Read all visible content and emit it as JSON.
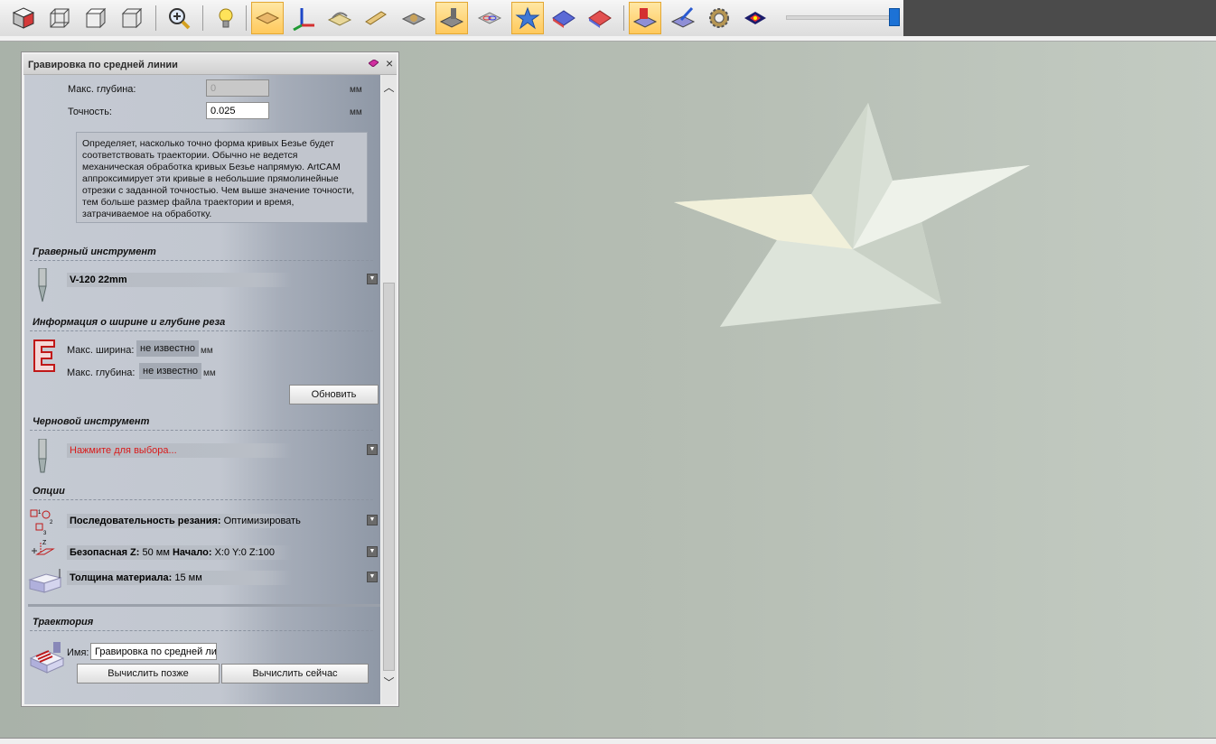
{
  "toolbar": {
    "icons": [
      "cube-icon",
      "wireframe-cube-icon",
      "box-outline-icon",
      "box-front-icon",
      "zoom-icon",
      "bulb-icon",
      "plane-view-icon",
      "axes-icon",
      "toolpath-icon",
      "material-block-icon",
      "relief-icon",
      "machine-icon",
      "layers-icon",
      "star-relief-icon",
      "blue-plane-icon",
      "red-plane-icon",
      "red-tool-icon",
      "paint-brush-icon",
      "gear-icon",
      "shading-icon"
    ]
  },
  "panel": {
    "title": "Гравировка по средней линии",
    "max_depth_label": "Макс. глубина:",
    "max_depth_value": "0",
    "max_depth_unit": "мм",
    "accuracy_label": "Точность:",
    "accuracy_value": "0.025",
    "accuracy_unit": "мм",
    "hint": "Определяет, насколько точно форма кривых Безье будет соответствовать траектории. Обычно не ведется механическая обработка кривых Безье напрямую. ArtCAM аппроксимирует эти кривые в небольшие прямолинейные отрезки с заданной точностью. Чем выше значение точности, тем больше размер файла траектории и время, затрачиваемое на обработку.",
    "engraving_tool": {
      "title": "Граверный инструмент",
      "value": "V-120 22mm"
    },
    "cut_info": {
      "title": "Информация о ширине и глубине реза",
      "max_width_label": "Макс. ширина:",
      "max_width_value": "не известно",
      "max_depth_label": "Макс. глубина:",
      "max_depth_value": "не известно",
      "unit": "мм",
      "update_button": "Обновить"
    },
    "rough_tool": {
      "title": "Черновой инструмент",
      "value": "Нажмите для выбора..."
    },
    "options": {
      "title": "Опции",
      "sequence_label": "Последовательность резания:",
      "sequence_value": "Оптимизировать",
      "safe_z_label": "Безопасная Z:",
      "safe_z_value": "50 мм",
      "start_label": "Начало:",
      "start_value": "X:0 Y:0 Z:100",
      "thickness_label": "Толщина материала:",
      "thickness_value": "15 мм"
    },
    "toolpath": {
      "title": "Траектория",
      "name_label": "Имя:",
      "name_value": "Гравировка по средней линии",
      "calc_later_button": "Вычислить позже",
      "calc_now_button": "Вычислить сейчас"
    }
  },
  "colors": {
    "toolbar_bg": "#4b4b4b",
    "viewport_bg": "#b5bdb3",
    "star_fill": "#e6ece4",
    "warning_red": "#d91b1b",
    "slider_blue": "#1c72d6"
  }
}
